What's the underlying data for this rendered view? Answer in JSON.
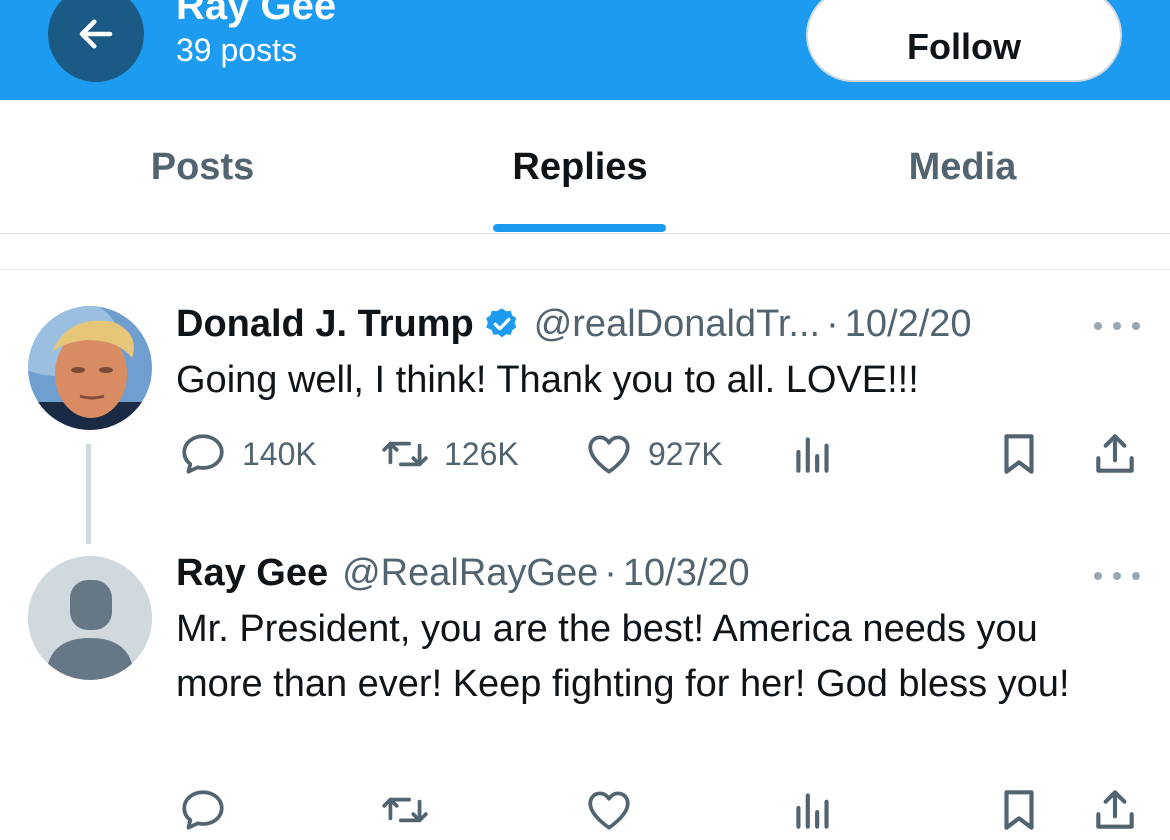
{
  "header": {
    "profile_name": "Ray Gee",
    "post_count": "39 posts",
    "follow_label": "Follow"
  },
  "tabs": [
    {
      "label": "Posts",
      "active": false
    },
    {
      "label": "Replies",
      "active": true
    },
    {
      "label": "Media",
      "active": false
    }
  ],
  "tweets": [
    {
      "author": "Donald J. Trump",
      "verified": true,
      "handle": "@realDonaldTr...",
      "separator": "·",
      "date": "10/2/20",
      "text": "Going well, I think! Thank you to all. LOVE!!!",
      "replies": "140K",
      "retweets": "126K",
      "likes": "927K"
    },
    {
      "author": "Ray Gee",
      "verified": false,
      "handle": "@RealRayGee",
      "separator": "·",
      "date": "10/3/20",
      "text": "Mr. President, you are the best! America needs you more than ever! Keep fighting for her! God bless you!"
    }
  ],
  "colors": {
    "accent": "#1d9bf0",
    "text_primary": "#0f1419",
    "text_secondary": "#536471",
    "back_button": "#1a5a85"
  },
  "icons": {
    "back": "arrow-left-icon",
    "verified": "verified-badge-icon",
    "more": "more-dots-icon",
    "reply": "reply-icon",
    "retweet": "retweet-icon",
    "like": "heart-icon",
    "views": "views-icon",
    "bookmark": "bookmark-icon",
    "share": "share-icon"
  }
}
